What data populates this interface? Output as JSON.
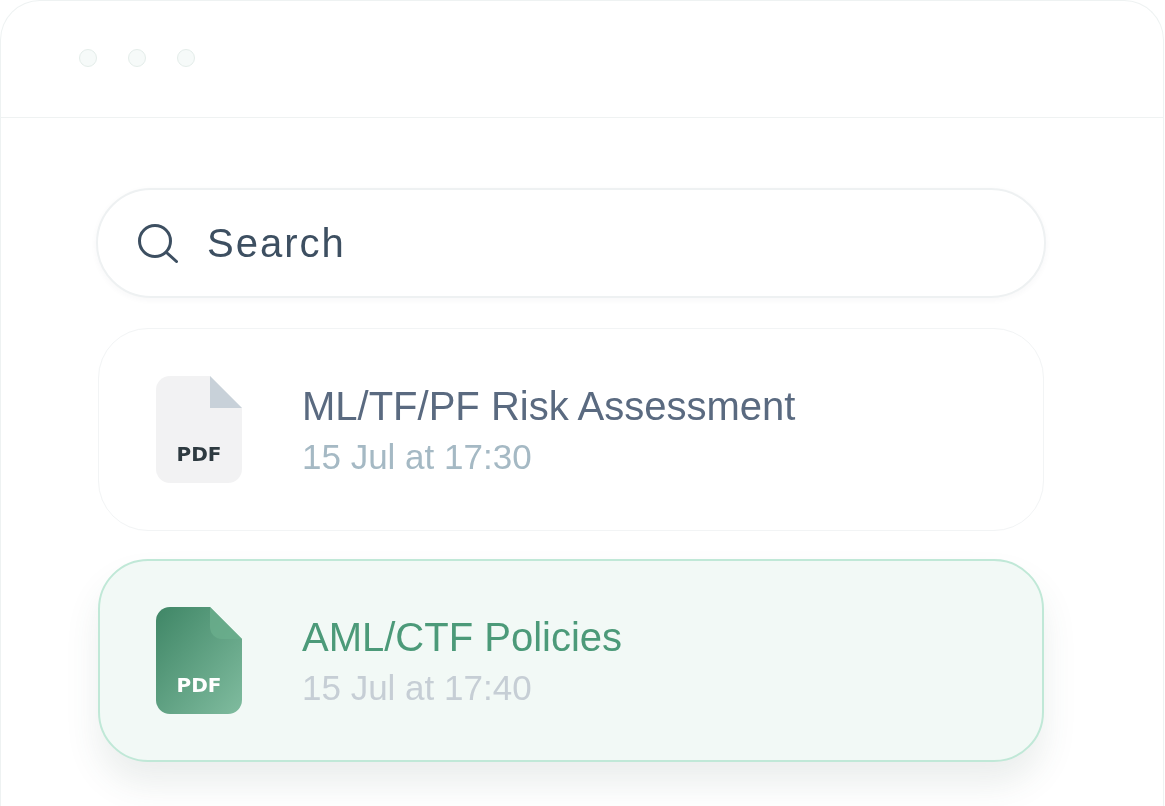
{
  "search": {
    "placeholder": "Search"
  },
  "files": [
    {
      "type": "PDF",
      "title": "ML/TF/PF Risk Assessment",
      "date": "15 Jul at 17:30",
      "selected": false
    },
    {
      "type": "PDF",
      "title": "AML/CTF Policies",
      "date": "15 Jul at 17:40",
      "selected": true
    }
  ]
}
